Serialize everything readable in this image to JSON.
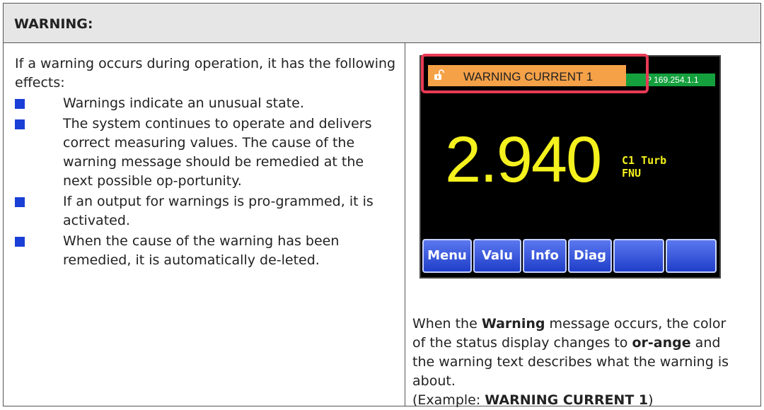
{
  "header": {
    "title": "WARNING:"
  },
  "left": {
    "intro": "If a warning occurs during operation, it has the following effects:",
    "items": [
      "Warnings indicate an unusual state.",
      "The system continues to operate and delivers correct measuring values. The cause of the warning message should be remedied at the next possible op-portunity.",
      "If an output for warnings is pro-grammed, it is activated.",
      "When the cause of the warning has been remedied, it is automatically de-leted."
    ]
  },
  "screen": {
    "warning_text": "WARNING CURRENT 1",
    "ip_text": "P 169.254.1.1",
    "value": "2.940",
    "unit_line1": "C1 Turb",
    "unit_line2": "FNU",
    "buttons": [
      "Menu",
      "Valu",
      "Info",
      "Diag",
      "",
      ""
    ],
    "colors": {
      "status_bar": "#f5a147",
      "value_text": "#f4f11e",
      "ip_bar": "#15a03e",
      "highlight": "#e83a55"
    }
  },
  "caption": {
    "p1": "When the ",
    "b1": "Warning",
    "p2": " message occurs, the color of the status display changes to ",
    "b2": "or-ange",
    "p3": " and the warning text describes what the warning is about.",
    "p4": "(Example: ",
    "b3": "WARNING CURRENT 1",
    "p5": ")"
  }
}
